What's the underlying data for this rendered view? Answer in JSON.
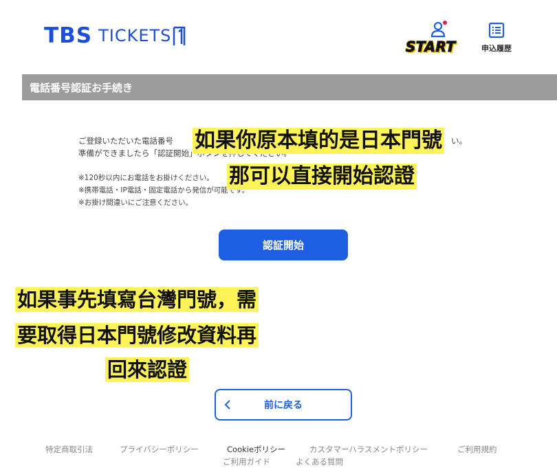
{
  "header": {
    "logo_tbs": "TBS",
    "logo_tickets": "TICKETS",
    "start_label": "START",
    "history_label": "申込履歴"
  },
  "section": {
    "title": "電話番号認証お手続き"
  },
  "instructions": {
    "line1_visible_start": "ご登録いただいた電話番号",
    "line1_visible_end": "い。",
    "line2_visible": "準備ができましたら「認証開始」ボタンを押してください。",
    "note1": "※120秒以内にお電話をお掛けください。",
    "note2": "※携帯電話・IP電話・固定電話から発信が可能です。",
    "note3": "※お掛け間違いにご注意ください。"
  },
  "annotations": {
    "line1": "如果你原本填的是日本門號",
    "line2": "那可以直接開始認證",
    "line3": "如果事先填寫台灣門號，需",
    "line4": "要取得日本門號修改資料再",
    "line5": "回來認證"
  },
  "buttons": {
    "start_auth": "認証開始",
    "back": "前に戻る"
  },
  "footer": {
    "links": [
      "特定商取引法",
      "プライバシーポリシー",
      "Cookieポリシー",
      "カスタマーハラスメントポリシー",
      "ご利用規約",
      "ご利用ガイド",
      "よくある質問"
    ]
  },
  "colors": {
    "brand_blue": "#1d5fe0",
    "section_gray": "#9c9c9c",
    "annotation_yellow": "#fff35a"
  },
  "icons": {
    "user": "user-icon",
    "history": "list-icon",
    "back": "chevron-left-icon"
  }
}
